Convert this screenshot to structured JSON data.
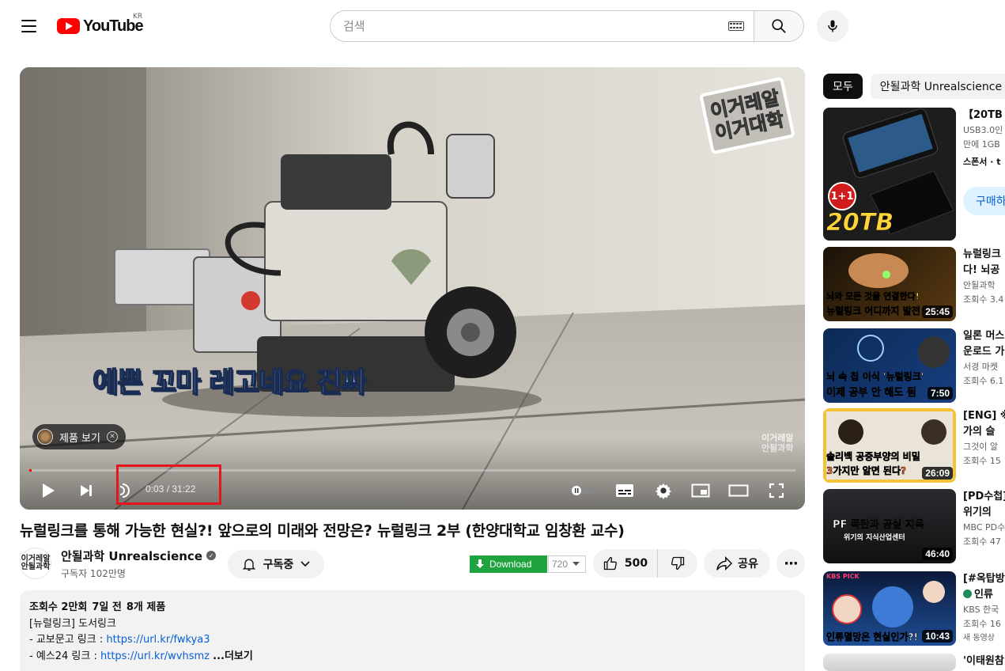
{
  "masthead": {
    "logo_text": "YouTube",
    "country": "KR",
    "search_placeholder": "검색"
  },
  "player": {
    "caption": "예쁜 꼬마 레고네요 진짜",
    "corner_logo": "이거레알\n이거대학",
    "watermark": "이거레알\n안될과학",
    "product_chip": "제품 보기",
    "current_time": "0:03",
    "duration": "31:22",
    "time_display": "0:03 / 31:22",
    "progress_fraction": 0.0016
  },
  "video": {
    "title": "뉴럴링크를 통해 가능한 현실?! 앞으로의 미래와 전망은? 뉴럴링크 2부 (한양대학교 임창환 교수)",
    "channel_name": "안될과학 Unrealscience",
    "channel_avatar_text": "이거레알\n안될과학",
    "subscribers": "구독자 102만명",
    "subscribe_label": "구독중",
    "download_label": "Download",
    "quality_label": "720",
    "likes": "500",
    "share_label": "공유"
  },
  "description": {
    "views": "조회수 2만회",
    "age": "7일 전",
    "products": "8개 제품",
    "line1": "[뉴럴링크] 도서링크",
    "line2_prefix": "- 교보문고 링크 : ",
    "line2_link": "https://url.kr/fwkya3",
    "line3_prefix": "- 예스24 링크 : ",
    "line3_link": "https://url.kr/wvhsmz",
    "more_label": "...더보기"
  },
  "sidebar": {
    "chips": [
      "모두",
      "안될과학 Unrealscience 제"
    ],
    "items": [
      {
        "title": "【20TB 1",
        "line1": "USB3.0인",
        "line2": "만에 1GB",
        "line3": "스폰서 · t",
        "thumb_caption": "20TB",
        "badge": "1+1",
        "buy_label": "구매하"
      },
      {
        "title": "뉴럴링크",
        "line1": "다! 뇌공",
        "line2": "안될과학",
        "line3": "조회수 3.4",
        "duration": "25:45",
        "thumb_caption1": "뇌와 모든 것을 연결한다!",
        "thumb_caption2": "뉴럴링크 어디까지 발전"
      },
      {
        "title": "일론 머스",
        "line1": "운로드 가",
        "line2": "서경 마켓",
        "line3": "조회수 6.1",
        "duration": "7:50",
        "thumb_caption1": "뇌 속 칩 이식 '뉴럴링크'",
        "thumb_caption2": "이제 공부 안 해도 됨"
      },
      {
        "title": "[ENG] ※",
        "line1": "가의 슬",
        "line2": "그것이 알",
        "line3": "조회수 15",
        "duration": "26:09",
        "thumb_caption1": "솔리백 공중부양의 비밀",
        "thumb_caption2": "3가지만 알면 된다?"
      },
      {
        "title": "[PD수첩]",
        "line1": "위기의 ",
        "line2": "MBC PD수",
        "line3": "조회수 47",
        "duration": "46:40",
        "thumb_caption1": "PF 폭탄과 공실 지옥",
        "thumb_caption2": "위기의 지식산업센터"
      },
      {
        "title": "[#옥탑방",
        "line1": "인류",
        "line2": "KBS 한국",
        "line3": "조회수 16",
        "duration": "10:43",
        "thumb_caption1": "인류멸망은 현실인가?!",
        "badge": "KBS PICK",
        "new_label": "새 동영상"
      },
      {
        "title": "'이태원참"
      }
    ]
  },
  "colors": {
    "accent_red": "#ff0000",
    "highlight_box": "#e8141c",
    "link_blue": "#065fd4",
    "download_green": "#1fa33f"
  }
}
